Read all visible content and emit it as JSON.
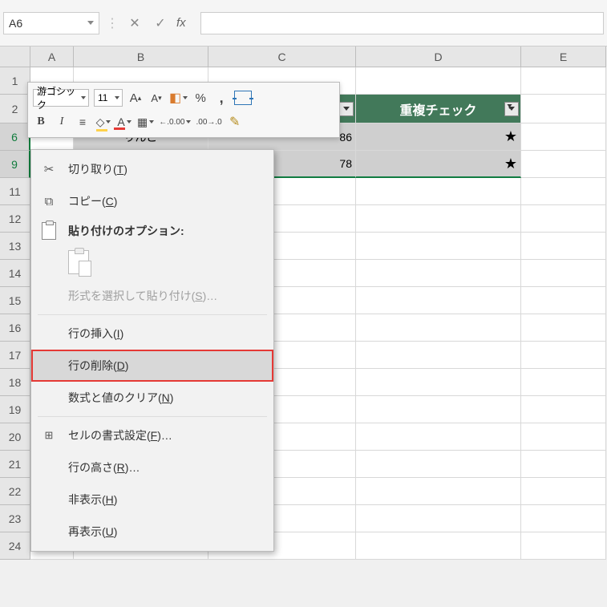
{
  "formula_bar": {
    "name_box": "A6",
    "fx_label": "fx"
  },
  "columns": [
    "A",
    "B",
    "C",
    "D",
    "E"
  ],
  "visible_rows": [
    "1",
    "2",
    "6",
    "9",
    "11",
    "12",
    "13",
    "14",
    "15",
    "16",
    "17",
    "18",
    "19",
    "20",
    "21",
    "22",
    "23",
    "24"
  ],
  "header_row2": {
    "D": "重複チェック"
  },
  "data_rows": {
    "6": {
      "B": "りんご",
      "C": "86",
      "D": "★"
    },
    "9": {
      "B": "",
      "C": "78",
      "D": "★"
    }
  },
  "mini_toolbar": {
    "font_name": "游ゴシック",
    "font_size": "11",
    "increase_font": "A",
    "decrease_font": "A",
    "bold": "B",
    "italic": "I",
    "underline_A": "A",
    "percent": "%",
    "comma": ",",
    "inc_dec_1": ".00",
    "inc_dec_2": ".00"
  },
  "context_menu": {
    "cut": "切り取り(T)",
    "copy": "コピー(C)",
    "paste_options": "貼り付けのオプション:",
    "paste_special": "形式を選択して貼り付け(S)…",
    "insert_row": "行の挿入(I)",
    "delete_row": "行の削除(D)",
    "clear_contents": "数式と値のクリア(N)",
    "format_cells": "セルの書式設定(F)…",
    "row_height": "行の高さ(R)…",
    "hide": "非表示(H)",
    "unhide": "再表示(U)"
  }
}
